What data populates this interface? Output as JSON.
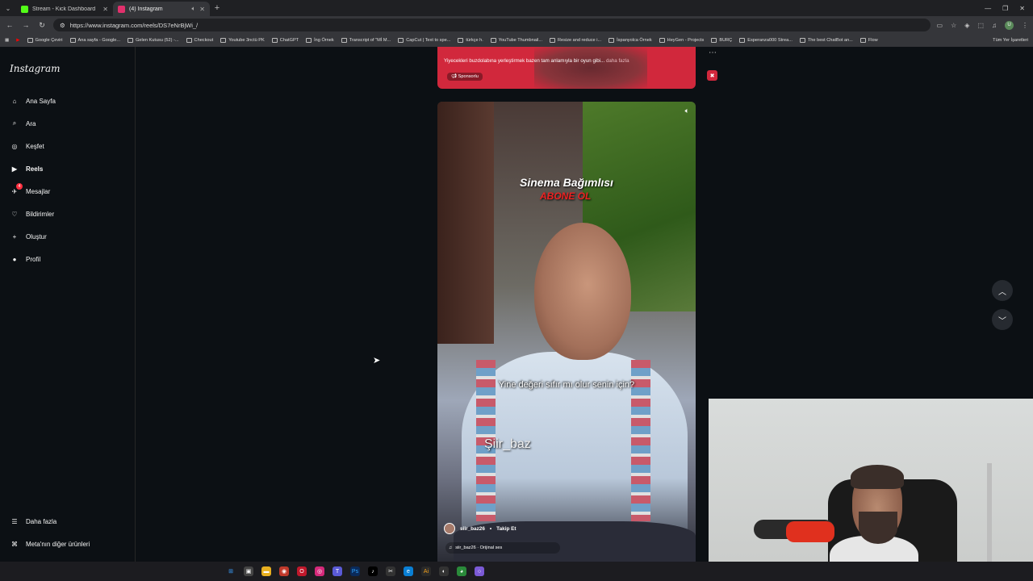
{
  "browser": {
    "tabs": [
      {
        "title": "Stream - Kick Dashboard",
        "color": "#53fc18"
      },
      {
        "title": "(4) Instagram",
        "color": "#e1306c"
      }
    ],
    "url": "https://www.instagram.com/reels/DS7eNrBjWi_/",
    "bookmarks": [
      "Google Çeviri",
      "Ana sayfa - Google...",
      "Gelen Kutusu (52) -...",
      "Checkout",
      "Youtube 3nctü PK",
      "ChatGPT",
      "İng Örnek",
      "Transcript of \"Mİ M...",
      "CapCut | Text to spe...",
      "türkçe h.",
      "YouTube Thumbnail...",
      "Resize and reduce i...",
      "İspanyolca Örnek",
      "HeyGen - Projects",
      "BURÇ",
      "Esperanza000 Strea...",
      "The best ChatBot an...",
      "Flow"
    ],
    "all_bookmarks": "Tüm Yer İşaretleri",
    "profile_initial": "U"
  },
  "instagram": {
    "logo": "Instagram",
    "nav": [
      {
        "label": "Ana Sayfa",
        "icon": "home-icon",
        "glyph": "⌂"
      },
      {
        "label": "Ara",
        "icon": "search-icon",
        "glyph": "⌕"
      },
      {
        "label": "Keşfet",
        "icon": "compass-icon",
        "glyph": "◎"
      },
      {
        "label": "Reels",
        "icon": "reels-icon",
        "glyph": "▶"
      },
      {
        "label": "Mesajlar",
        "icon": "messenger-icon",
        "glyph": "✈"
      },
      {
        "label": "Bildirimler",
        "icon": "heart-icon",
        "glyph": "♡"
      },
      {
        "label": "Oluştur",
        "icon": "plus-icon",
        "glyph": "+"
      },
      {
        "label": "Profil",
        "icon": "profile-avatar-icon",
        "glyph": "●"
      }
    ],
    "messages_badge": "4",
    "more": "Daha fazla",
    "meta": "Meta'nın diğer ürünleri"
  },
  "sponsored_post": {
    "caption": "Yiyecekleri buzdolabına yerleştirmek bazen tam anlamıyla bir oyun gibi... ",
    "more": "daha fazla",
    "label": "Sponsorlu"
  },
  "reel": {
    "title": "Sinema Bağımlısı",
    "subtitle": "ABONE OL",
    "caption_text": "Yine değeri sıfır mı olur senin için?",
    "watermark": "Şiir_baz",
    "username": "siir_baz26",
    "separator": "•",
    "follow": "Takip Et",
    "audio": "siir_baz26 · Orijinal ses"
  }
}
